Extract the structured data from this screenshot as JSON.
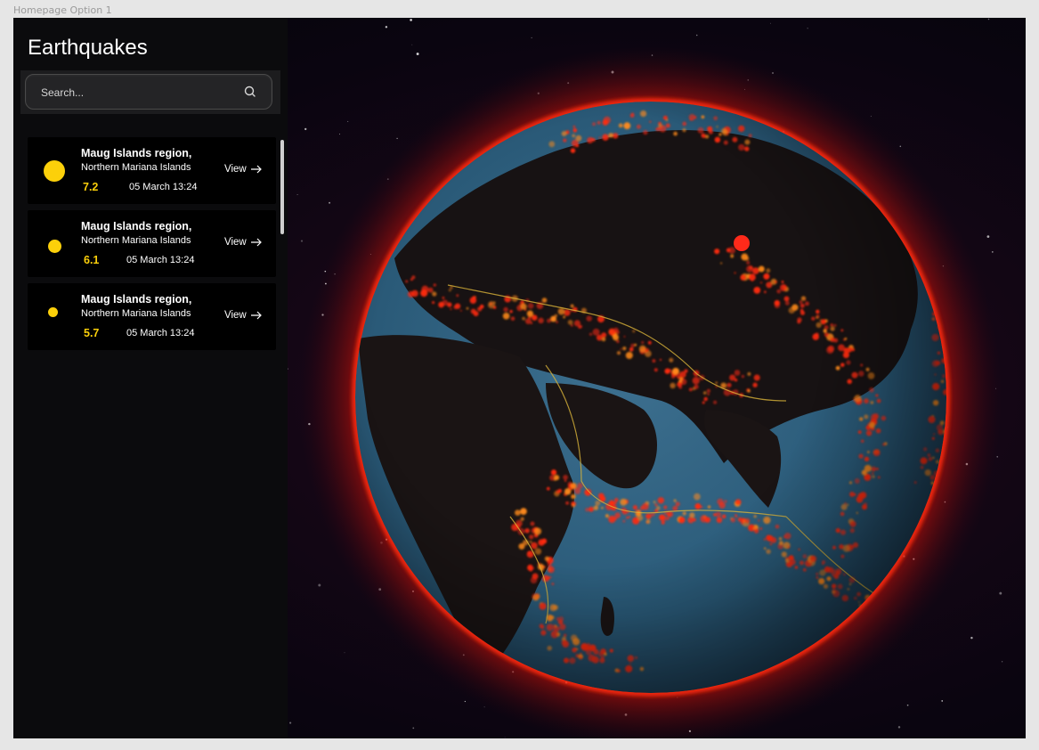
{
  "frame": {
    "label": "Homepage Option 1"
  },
  "app": {
    "title": "Earthquakes"
  },
  "search": {
    "placeholder": "Search..."
  },
  "quakes": [
    {
      "region": "Maug Islands region,",
      "country": "Northern Mariana Islands",
      "magnitude": "7.2",
      "datetime": "05 March 13:24",
      "action": "View"
    },
    {
      "region": "Maug Islands region,",
      "country": "Northern Mariana Islands",
      "magnitude": "6.1",
      "datetime": "05 March 13:24",
      "action": "View"
    },
    {
      "region": "Maug Islands region,",
      "country": "Northern Mariana Islands",
      "magnitude": "5.7",
      "datetime": "05 March 13:24",
      "action": "View"
    }
  ],
  "colors": {
    "magnitude_dot": "#fcd00a",
    "quake_glow": "#ff2a10",
    "plate_boundary": "#d9b33a",
    "ocean": "#2a5a78",
    "land": "#1a1414"
  },
  "icons": {
    "search": "search-icon",
    "view": "arrow-right-icon"
  }
}
